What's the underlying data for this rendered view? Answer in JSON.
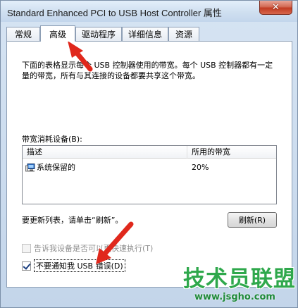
{
  "window": {
    "title": "Standard Enhanced PCI to USB Host Controller 属性",
    "close_glyph": "✕"
  },
  "tabs": [
    {
      "label": "常规",
      "active": false
    },
    {
      "label": "高级",
      "active": true
    },
    {
      "label": "驱动程序",
      "active": false
    },
    {
      "label": "详细信息",
      "active": false
    },
    {
      "label": "资源",
      "active": false
    }
  ],
  "advanced": {
    "description": "下面的表格显示每个 USB 控制器使用的带宽。每个 USB 控制器都有一定量的带宽，所有与其连接的设备都要共享这个带宽。",
    "group_label": "带宽消耗设备(B):",
    "columns": {
      "device": "描述",
      "bandwidth": "所用的带宽"
    },
    "rows": [
      {
        "device": "系统保留的",
        "bandwidth": "20%",
        "icon": "computer-icon"
      }
    ],
    "refresh_hint": "要更新列表，请单击“刷新”。",
    "refresh_button": "刷新(R)",
    "checkbox_fast": {
      "label": "告诉我设备是否可以更快速执行(T)",
      "checked": false,
      "enabled": false
    },
    "checkbox_notify": {
      "label": "不要通知我 USB 错误(D)",
      "checked": true,
      "enabled": true
    }
  },
  "watermark": {
    "brand": "技术员联盟",
    "url": "www.jsgho.com"
  },
  "colors": {
    "annotation_red": "#e0281c",
    "watermark_green": "#2fa84c"
  }
}
